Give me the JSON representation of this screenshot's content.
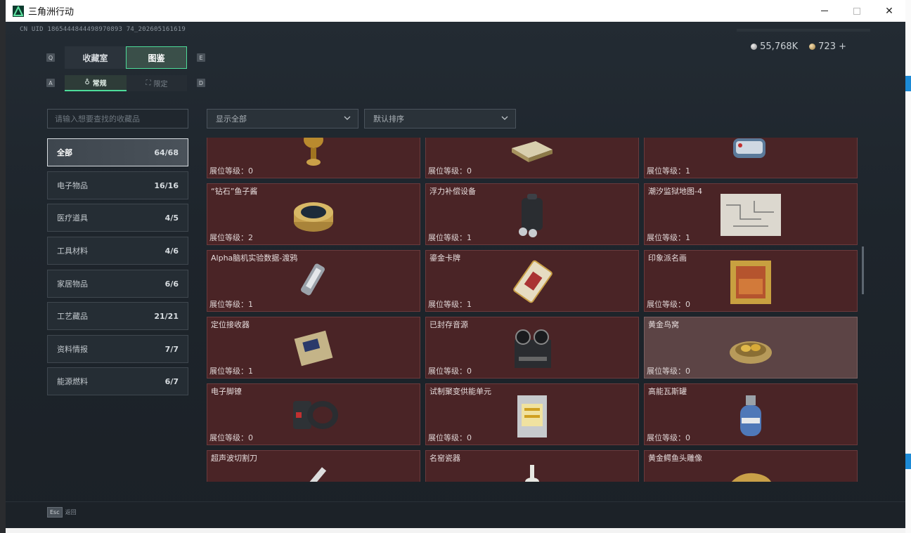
{
  "window": {
    "title": "三角洲行动"
  },
  "header": {
    "uid": "CN UID 1865444844498970893 74_202605161619",
    "currency_silver": "55,768K",
    "currency_gold": "723 +",
    "tabs": [
      "收藏室",
      "图鉴"
    ],
    "subtabs": [
      "常规",
      "限定"
    ],
    "keys": {
      "q": "Q",
      "e": "E",
      "a": "A",
      "d": "D"
    }
  },
  "filters": {
    "search_placeholder": "请输入想要查找的收藏品",
    "show": "显示全部",
    "sort": "默认排序"
  },
  "categories": [
    {
      "label": "全部",
      "count": "64/68"
    },
    {
      "label": "电子物品",
      "count": "16/16"
    },
    {
      "label": "医疗道具",
      "count": "4/5"
    },
    {
      "label": "工具材料",
      "count": "4/6"
    },
    {
      "label": "家居物品",
      "count": "6/6"
    },
    {
      "label": "工艺藏品",
      "count": "21/21"
    },
    {
      "label": "资料情报",
      "count": "7/7"
    },
    {
      "label": "能源燃料",
      "count": "6/7"
    }
  ],
  "items": [
    {
      "name": "",
      "level": "展位等级：0",
      "icon": "trophy-icon"
    },
    {
      "name": "",
      "level": "展位等级：0",
      "icon": "chessboard-icon"
    },
    {
      "name": "",
      "level": "展位等级：1",
      "icon": "device-icon"
    },
    {
      "name": "“钻石”鱼子酱",
      "level": "展位等级：2",
      "icon": "caviar-tin-icon"
    },
    {
      "name": "浮力补偿设备",
      "level": "展位等级：1",
      "icon": "buoyancy-device-icon"
    },
    {
      "name": "潮汐监狱地图-4",
      "level": "展位等级：1",
      "icon": "map-icon"
    },
    {
      "name": "Alpha脑机实验数据-渡鸦",
      "level": "展位等级：1",
      "icon": "usb-drive-icon"
    },
    {
      "name": "鎏金卡牌",
      "level": "展位等级：1",
      "icon": "gold-card-icon"
    },
    {
      "name": "印象派名画",
      "level": "展位等级：0",
      "icon": "painting-icon"
    },
    {
      "name": "定位接收器",
      "level": "展位等级：1",
      "icon": "receiver-icon"
    },
    {
      "name": "已封存音源",
      "level": "展位等级：0",
      "icon": "tape-recorder-icon"
    },
    {
      "name": "黄金鸟窝",
      "level": "展位等级：0",
      "icon": "golden-nest-icon"
    },
    {
      "name": "电子脚镣",
      "level": "展位等级：0",
      "icon": "ankle-monitor-icon"
    },
    {
      "name": "试制聚变供能单元",
      "level": "展位等级：0",
      "icon": "fusion-cell-icon"
    },
    {
      "name": "高能瓦斯罐",
      "level": "展位等级：0",
      "icon": "gas-tank-icon"
    },
    {
      "name": "超声波切割刀",
      "level": "",
      "icon": "cutter-icon"
    },
    {
      "name": "名窑瓷器",
      "level": "",
      "icon": "porcelain-icon"
    },
    {
      "name": "黄金鳄鱼头雕像",
      "level": "",
      "icon": "croc-statue-icon"
    }
  ],
  "footer": {
    "esc_key": "Esc",
    "esc_label": "返回"
  }
}
